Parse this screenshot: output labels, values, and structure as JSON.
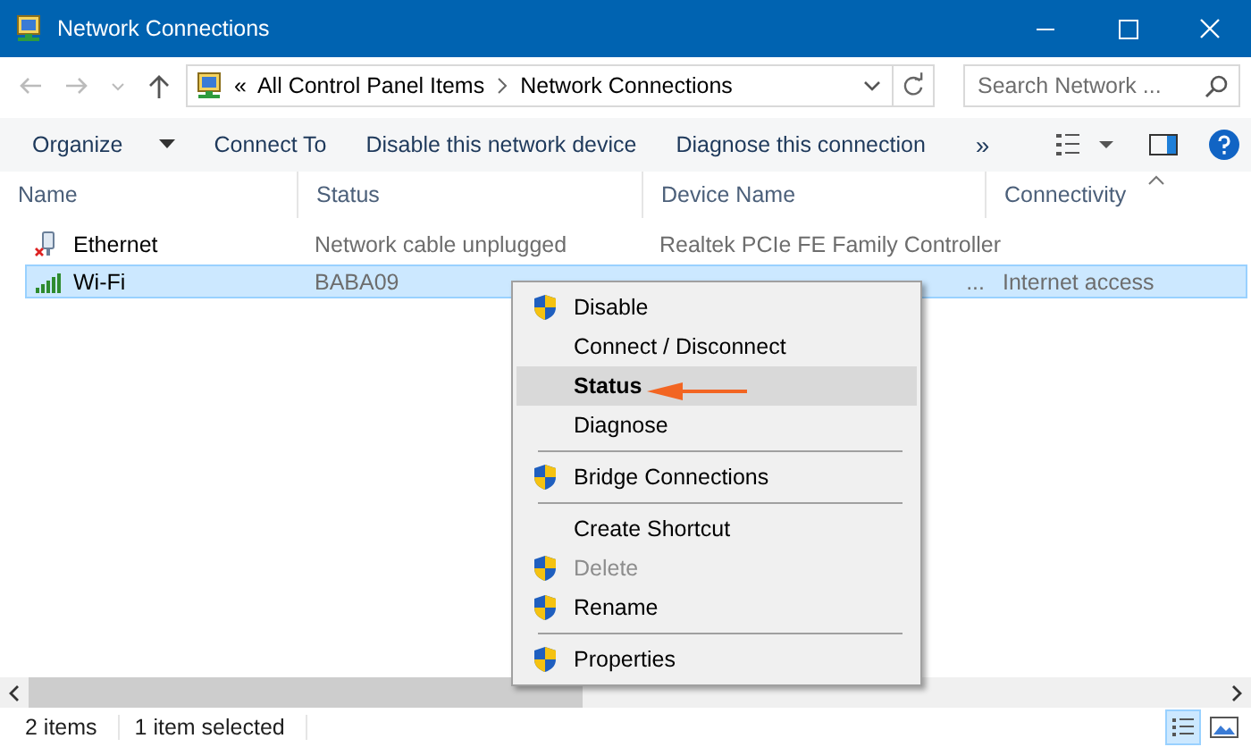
{
  "window": {
    "title": "Network Connections"
  },
  "address": {
    "overflow": "«",
    "crumbs": [
      "All Control Panel Items",
      "Network Connections"
    ]
  },
  "search": {
    "placeholder": "Search Network ..."
  },
  "toolbar": {
    "items": [
      {
        "label": "Organize",
        "dropdown": true
      },
      {
        "label": "Connect To",
        "dropdown": false
      },
      {
        "label": "Disable this network device",
        "dropdown": false
      },
      {
        "label": "Diagnose this connection",
        "dropdown": false
      }
    ],
    "more": "»"
  },
  "table": {
    "columns": [
      "Name",
      "Status",
      "Device Name",
      "Connectivity"
    ],
    "rows": [
      {
        "kind": "ethernet",
        "selected": false,
        "cells": [
          "Ethernet",
          "Network cable unplugged",
          "Realtek PCIe FE Family Controller",
          ""
        ]
      },
      {
        "kind": "wifi",
        "selected": true,
        "cells": [
          "Wi-Fi",
          "BABA09",
          "...",
          "Internet access"
        ]
      }
    ]
  },
  "context_menu": {
    "items": [
      {
        "kind": "item",
        "label": "Disable",
        "shield": true,
        "bold": false,
        "selected": false,
        "disabled": false
      },
      {
        "kind": "item",
        "label": "Connect / Disconnect",
        "shield": false,
        "bold": false,
        "selected": false,
        "disabled": false
      },
      {
        "kind": "item",
        "label": "Status",
        "shield": false,
        "bold": true,
        "selected": true,
        "disabled": false
      },
      {
        "kind": "item",
        "label": "Diagnose",
        "shield": false,
        "bold": false,
        "selected": false,
        "disabled": false
      },
      {
        "kind": "separator"
      },
      {
        "kind": "item",
        "label": "Bridge Connections",
        "shield": true,
        "bold": false,
        "selected": false,
        "disabled": false
      },
      {
        "kind": "separator"
      },
      {
        "kind": "item",
        "label": "Create Shortcut",
        "shield": false,
        "bold": false,
        "selected": false,
        "disabled": false
      },
      {
        "kind": "item",
        "label": "Delete",
        "shield": true,
        "bold": false,
        "selected": false,
        "disabled": true
      },
      {
        "kind": "item",
        "label": "Rename",
        "shield": true,
        "bold": false,
        "selected": false,
        "disabled": false
      },
      {
        "kind": "separator"
      },
      {
        "kind": "item",
        "label": "Properties",
        "shield": true,
        "bold": false,
        "selected": false,
        "disabled": false
      }
    ]
  },
  "status_bar": {
    "items": [
      "2 items",
      "1 item selected"
    ]
  }
}
